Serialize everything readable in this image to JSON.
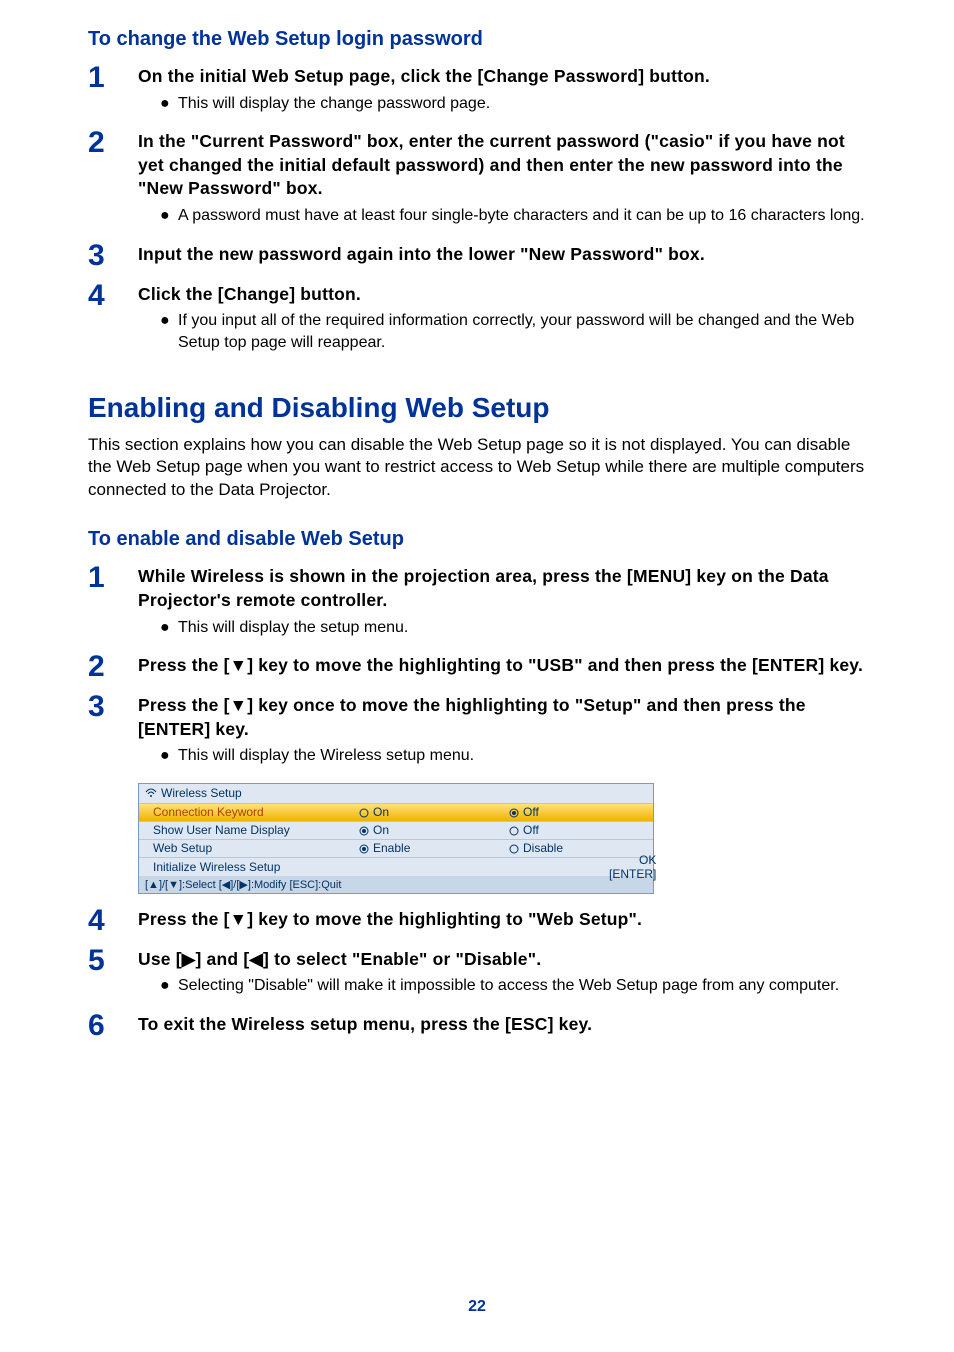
{
  "section1": {
    "heading": "To change the Web Setup login password",
    "steps": [
      {
        "num": "1",
        "title": "On the initial Web Setup page, click the [Change Password] button.",
        "bullets": [
          "This will display the change password page."
        ]
      },
      {
        "num": "2",
        "title": "In the \"Current Password\" box, enter the current password (\"casio\" if you have not yet changed the initial default password) and then enter the new password into the \"New Password\" box.",
        "bullets": [
          "A password must have at least four single-byte characters and it can be up to 16 characters long."
        ]
      },
      {
        "num": "3",
        "title": "Input the new password again into the lower \"New Password\" box.",
        "bullets": []
      },
      {
        "num": "4",
        "title": "Click the [Change] button.",
        "bullets": [
          "If you input all of the required information correctly, your password will be changed and the Web Setup top page will reappear."
        ]
      }
    ]
  },
  "section2": {
    "heading": "Enabling and Disabling Web Setup",
    "desc": "This section explains how you can disable the Web Setup page so it is not displayed. You can disable the Web Setup page when you want to restrict access to Web Setup while there are multiple computers connected to the Data Projector.",
    "subheading": "To enable and disable Web Setup",
    "steps": [
      {
        "num": "1",
        "title": "While Wireless is shown in the projection area, press the [MENU] key on the Data Projector's remote controller.",
        "bullets": [
          "This will display the setup menu."
        ]
      },
      {
        "num": "2",
        "title": "Press the [▼] key to move the highlighting to \"USB\" and then press the [ENTER] key.",
        "bullets": []
      },
      {
        "num": "3",
        "title": "Press the [▼] key once to move the highlighting to \"Setup\" and then press the [ENTER] key.",
        "bullets": [
          "This will display the Wireless setup menu."
        ]
      }
    ],
    "steps_after": [
      {
        "num": "4",
        "title": "Press the [▼] key to move the highlighting to \"Web Setup\".",
        "bullets": []
      },
      {
        "num": "5",
        "title": "Use [▶] and [◀] to select \"Enable\" or \"Disable\".",
        "bullets": [
          "Selecting \"Disable\" will make it impossible to access the Web Setup page from any computer."
        ]
      },
      {
        "num": "6",
        "title": "To exit the Wireless setup menu, press the [ESC] key.",
        "bullets": []
      }
    ]
  },
  "menu": {
    "title": "Wireless Setup",
    "rows": [
      {
        "label": "Connection Keyword",
        "opt1": "On",
        "opt2": "Off",
        "sel": 2,
        "highlight": true
      },
      {
        "label": "Show User Name Display",
        "opt1": "On",
        "opt2": "Off",
        "sel": 1,
        "highlight": false
      },
      {
        "label": "Web Setup",
        "opt1": "Enable",
        "opt2": "Disable",
        "sel": 1,
        "highlight": false
      },
      {
        "label": "Initialize Wireless Setup",
        "opt1": "",
        "opt2": "",
        "sel": 0,
        "highlight": false,
        "right": "OK [ENTER]"
      }
    ],
    "footer": "[▲]/[▼]:Select [◀]/[▶]:Modify [ESC]:Quit"
  },
  "page_number": "22"
}
